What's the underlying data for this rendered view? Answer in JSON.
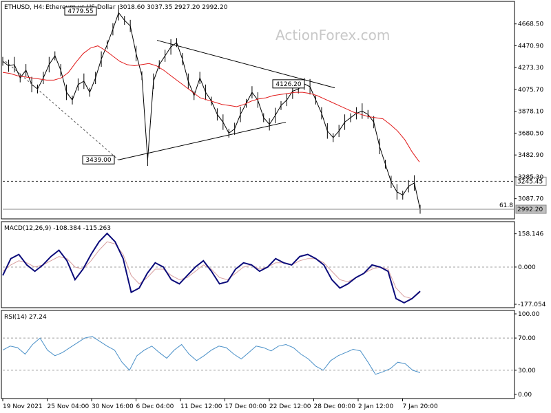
{
  "header": {
    "symbol": "ETHUSD, H4:",
    "description": "Ethereum vs US Dollar",
    "ohlc": "3018.60 3037.35 2927.20 2992.20"
  },
  "watermark": "ActionForex.com",
  "colors": {
    "price_line": "#000000",
    "ma": "#e11b1b",
    "macd": "#0b0b7a",
    "signal": "#d8a0a0",
    "rsi": "#4a90c8",
    "grid_dash": "#a0a0a0",
    "axis": "#000000"
  },
  "chart_data": [
    {
      "type": "candlestick-line",
      "panel": "price",
      "ylim": [
        2930,
        4760
      ],
      "y_ticks": [
        "4668.50",
        "4470.90",
        "4273.30",
        "4075.70",
        "3878.10",
        "3680.50",
        "3482.90",
        "3285.30",
        "3087.70"
      ],
      "x_ticks": [
        "19 Nov 2021",
        "25 Nov 04:00",
        "30 Nov 16:00",
        "6 Dec 04:00",
        "11 Dec 12:00",
        "17 Dec 00:00",
        "22 Dec 12:00",
        "28 Dec 00:00",
        "2 Jan 12:00",
        "7 Jan 20:00"
      ],
      "price_series": [
        4330,
        4290,
        4300,
        4180,
        4250,
        4120,
        4080,
        4180,
        4300,
        4380,
        4250,
        4050,
        3980,
        4120,
        4150,
        4050,
        4180,
        4350,
        4480,
        4620,
        4770,
        4700,
        4650,
        4400,
        4200,
        3439,
        4150,
        4300,
        4380,
        4460,
        4500,
        4350,
        4150,
        4020,
        4180,
        4050,
        3970,
        3850,
        3780,
        3680,
        3720,
        3850,
        3950,
        4050,
        3980,
        3820,
        3760,
        3840,
        3930,
        3980,
        4060,
        4080,
        4126,
        4100,
        3980,
        3860,
        3700,
        3640,
        3700,
        3780,
        3820,
        3860,
        3880,
        3850,
        3780,
        3560,
        3400,
        3240,
        3150,
        3120,
        3200,
        3230,
        2992
      ],
      "ma_series": [
        4230,
        4220,
        4200,
        4190,
        4180,
        4170,
        4160,
        4160,
        4180,
        4230,
        4320,
        4400,
        4450,
        4470,
        4430,
        4380,
        4330,
        4300,
        4290,
        4300,
        4310,
        4290,
        4250,
        4200,
        4150,
        4100,
        4050,
        4000,
        3980,
        3960,
        3940,
        3930,
        3920,
        3940,
        3970,
        3990,
        4000,
        4020,
        4030,
        4040,
        4050,
        4050,
        4040,
        4020,
        3990,
        3960,
        3930,
        3900,
        3870,
        3850,
        3830,
        3820,
        3810,
        3760,
        3700,
        3620,
        3510,
        3420
      ],
      "annotations": [
        {
          "label": "4779.55",
          "kind": "high"
        },
        {
          "label": "3439.00",
          "kind": "low"
        },
        {
          "label": "4126.20",
          "kind": "pivot"
        }
      ],
      "levels": [
        {
          "label": "3245.45",
          "value": 3245.45,
          "style": "dashed"
        },
        {
          "label": "2992.20",
          "value": 2992.2,
          "style": "solid"
        }
      ],
      "fib_label": "61.8"
    },
    {
      "type": "line",
      "panel": "macd",
      "title": "MACD(12,26,9) -108.384 -115.263",
      "ylim": [
        -190,
        170
      ],
      "y_ticks": [
        "158.146",
        "0.000",
        "-177.054"
      ],
      "macd": [
        -40,
        40,
        60,
        10,
        -20,
        10,
        50,
        80,
        30,
        -60,
        -10,
        60,
        120,
        160,
        120,
        40,
        -120,
        -100,
        -30,
        20,
        0,
        -60,
        -80,
        -40,
        0,
        30,
        -20,
        -80,
        -70,
        -10,
        20,
        10,
        -20,
        0,
        40,
        20,
        10,
        50,
        60,
        40,
        10,
        -60,
        -100,
        -80,
        -50,
        -30,
        10,
        0,
        -20,
        -150,
        -170,
        -150,
        -115
      ],
      "signal": [
        -20,
        10,
        30,
        20,
        0,
        10,
        30,
        50,
        40,
        0,
        -10,
        30,
        80,
        120,
        110,
        60,
        -40,
        -80,
        -50,
        -10,
        -10,
        -40,
        -60,
        -50,
        -20,
        10,
        -10,
        -50,
        -60,
        -30,
        0,
        10,
        -10,
        0,
        20,
        20,
        10,
        30,
        40,
        40,
        20,
        -20,
        -60,
        -70,
        -50,
        -30,
        -10,
        0,
        -10,
        -100,
        -140,
        -150,
        -120
      ]
    },
    {
      "type": "line",
      "panel": "rsi",
      "title": "RSI(14) 27.24",
      "ylim": [
        0,
        100
      ],
      "y_ticks": [
        "100.00",
        "70.00",
        "30.00",
        "0.00"
      ],
      "rsi": [
        55,
        60,
        58,
        50,
        62,
        70,
        55,
        48,
        52,
        58,
        64,
        70,
        72,
        66,
        60,
        55,
        40,
        30,
        48,
        55,
        60,
        52,
        45,
        55,
        62,
        50,
        42,
        48,
        55,
        60,
        58,
        50,
        44,
        52,
        60,
        58,
        54,
        60,
        62,
        58,
        50,
        44,
        35,
        30,
        42,
        48,
        52,
        56,
        54,
        40,
        25,
        28,
        32,
        40,
        38,
        30,
        27
      ]
    }
  ]
}
